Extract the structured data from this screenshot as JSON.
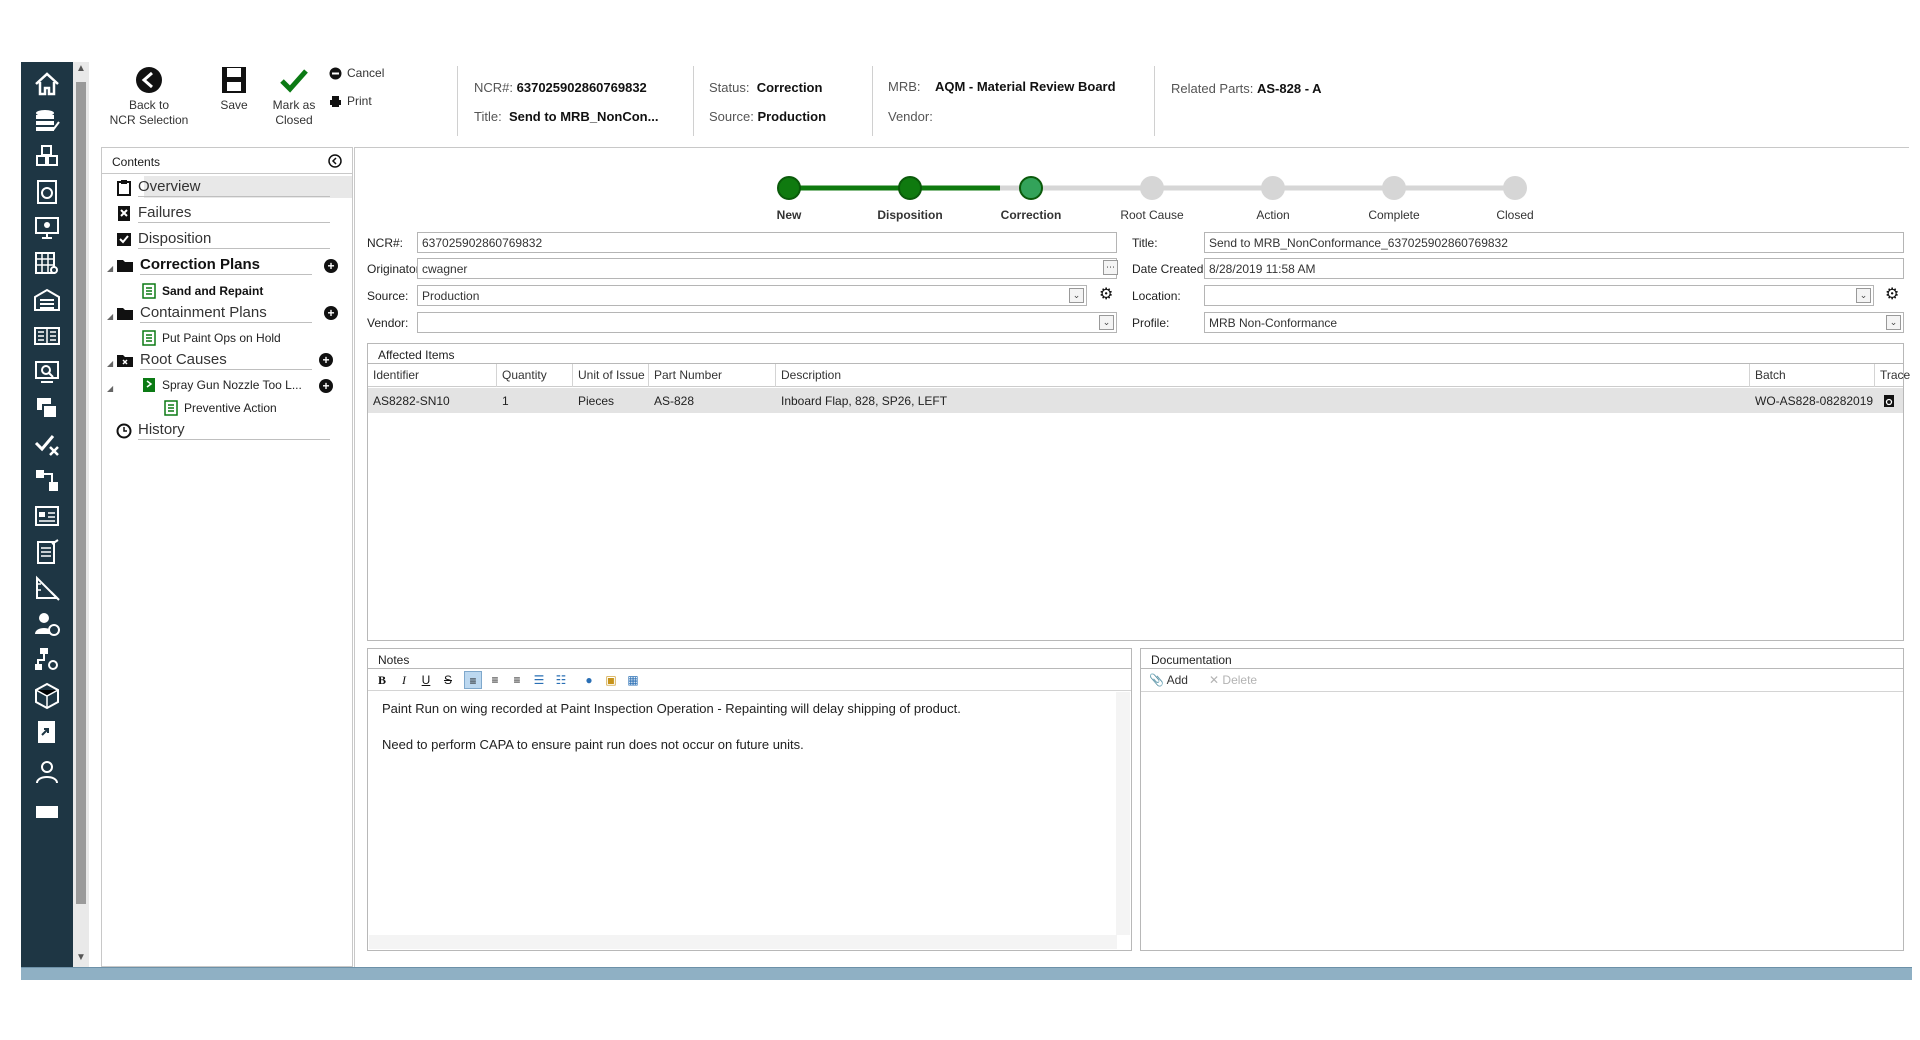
{
  "toolbar": {
    "back_label_1": "Back to",
    "back_label_2": "NCR Selection",
    "save_label": "Save",
    "mark_label_1": "Mark as",
    "mark_label_2": "Closed",
    "cancel_label": "Cancel",
    "print_label": "Print"
  },
  "header": {
    "ncr_label": "NCR#:",
    "ncr_value": "637025902860769832",
    "title_label": "Title:",
    "title_value": "Send to MRB_NonCon...",
    "status_label": "Status:",
    "status_value": "Correction",
    "source_label": "Source:",
    "source_value": "Production",
    "mrb_label": "MRB:",
    "mrb_value": "AQM - Material Review Board",
    "vendor_label": "Vendor:",
    "vendor_value": "",
    "related_label": "Related Parts:",
    "related_value": "AS-828 - A"
  },
  "contents": {
    "title": "Contents",
    "items": {
      "overview": "Overview",
      "failures": "Failures",
      "disposition": "Disposition",
      "correction_plans": "Correction Plans",
      "sand_repaint": "Sand and Repaint",
      "containment_plans": "Containment Plans",
      "put_paint": "Put Paint Ops on Hold",
      "root_causes": "Root Causes",
      "spray_gun": "Spray Gun Nozzle Too L...",
      "preventive": "Preventive Action",
      "history": "History"
    }
  },
  "workflow": {
    "steps": [
      "New",
      "Disposition",
      "Correction",
      "Root Cause",
      "Action",
      "Complete",
      "Closed"
    ],
    "current_step": "Correction",
    "colors": {
      "done": "#0f7a0f",
      "current": "#33a35a",
      "pending": "#d6d6d6"
    }
  },
  "form": {
    "ncr_label": "NCR#:",
    "ncr_value": "637025902860769832",
    "originator_label": "Originator:",
    "originator_value": "cwagner",
    "source_label": "Source:",
    "source_value": "Production",
    "vendor_label": "Vendor:",
    "vendor_value": "",
    "title_label": "Title:",
    "title_value": "Send to MRB_NonConformance_637025902860769832",
    "date_label": "Date Created:",
    "date_value": "8/28/2019 11:58 AM",
    "location_label": "Location:",
    "location_value": "",
    "profile_label": "Profile:",
    "profile_value": "MRB Non-Conformance"
  },
  "affected_items": {
    "title": "Affected Items",
    "columns": [
      "Identifier",
      "Quantity",
      "Unit of Issue",
      "Part Number",
      "Description",
      "Batch",
      "Trace"
    ],
    "rows": [
      {
        "identifier": "AS8282-SN10",
        "quantity": "1",
        "unit": "Pieces",
        "part": "AS-828",
        "description": "Inboard Flap, 828, SP26, LEFT",
        "batch": "WO-AS828-08282019"
      }
    ]
  },
  "notes": {
    "title": "Notes",
    "line1": "Paint Run on wing recorded at Paint Inspection Operation - Repainting will delay shipping of product.",
    "line2": "Need to perform CAPA to ensure paint run does not occur on future units."
  },
  "documentation": {
    "title": "Documentation",
    "add_label": "Add",
    "delete_label": "Delete"
  }
}
